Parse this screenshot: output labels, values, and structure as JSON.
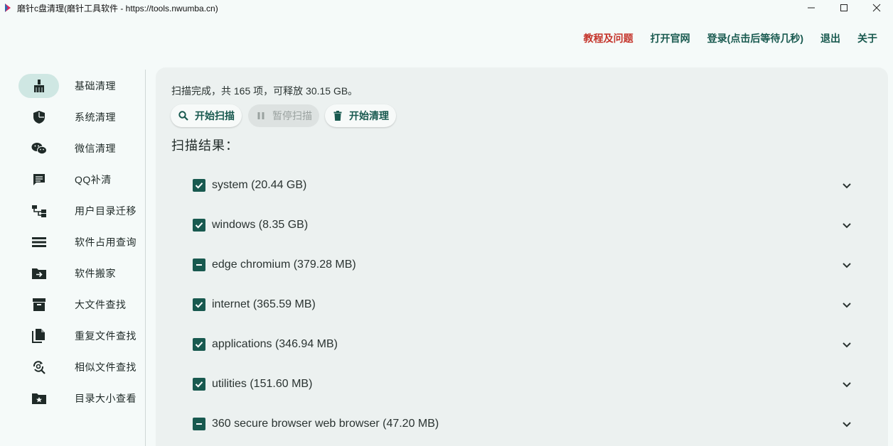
{
  "window": {
    "title": "磨针c盘清理(磨针工具软件 - https://tools.nwumba.cn)"
  },
  "topmenu": {
    "tutorial": "教程及问题",
    "website": "打开官网",
    "login": "登录(点击后等待几秒)",
    "logout": "退出",
    "about": "关于"
  },
  "sidebar": {
    "items": [
      {
        "label": "基础清理",
        "icon": "broom-icon",
        "active": true
      },
      {
        "label": "系统清理",
        "icon": "shield-icon"
      },
      {
        "label": "微信清理",
        "icon": "wechat-icon"
      },
      {
        "label": "QQ补清",
        "icon": "chat-icon"
      },
      {
        "label": "用户目录迁移",
        "icon": "tree-icon"
      },
      {
        "label": "软件占用查询",
        "icon": "list-icon"
      },
      {
        "label": "软件搬家",
        "icon": "folder-move-icon"
      },
      {
        "label": "大文件查找",
        "icon": "archive-icon"
      },
      {
        "label": "重复文件查找",
        "icon": "copy-icon"
      },
      {
        "label": "相似文件查找",
        "icon": "search-refresh-icon"
      },
      {
        "label": "目录大小查看",
        "icon": "folder-star-icon"
      }
    ]
  },
  "main": {
    "status": "扫描完成，共 165 项，可释放 30.15 GB。",
    "buttons": {
      "start_scan": "开始扫描",
      "pause_scan": "暂停扫描",
      "start_clean": "开始清理"
    },
    "results_title": "扫描结果：",
    "results": [
      {
        "label": "system (20.44 GB)",
        "state": "checked"
      },
      {
        "label": "windows (8.35 GB)",
        "state": "checked"
      },
      {
        "label": "edge chromium (379.28 MB)",
        "state": "indeterminate"
      },
      {
        "label": "internet (365.59 MB)",
        "state": "checked"
      },
      {
        "label": "applications (346.94 MB)",
        "state": "checked"
      },
      {
        "label": "utilities (151.60 MB)",
        "state": "checked"
      },
      {
        "label": "360 secure browser web browser (47.20 MB)",
        "state": "indeterminate"
      }
    ]
  },
  "colors": {
    "accent": "#18594f",
    "red_link": "#c5362d",
    "active_pill": "#cfe7e3",
    "panel": "#ecf1f0"
  }
}
